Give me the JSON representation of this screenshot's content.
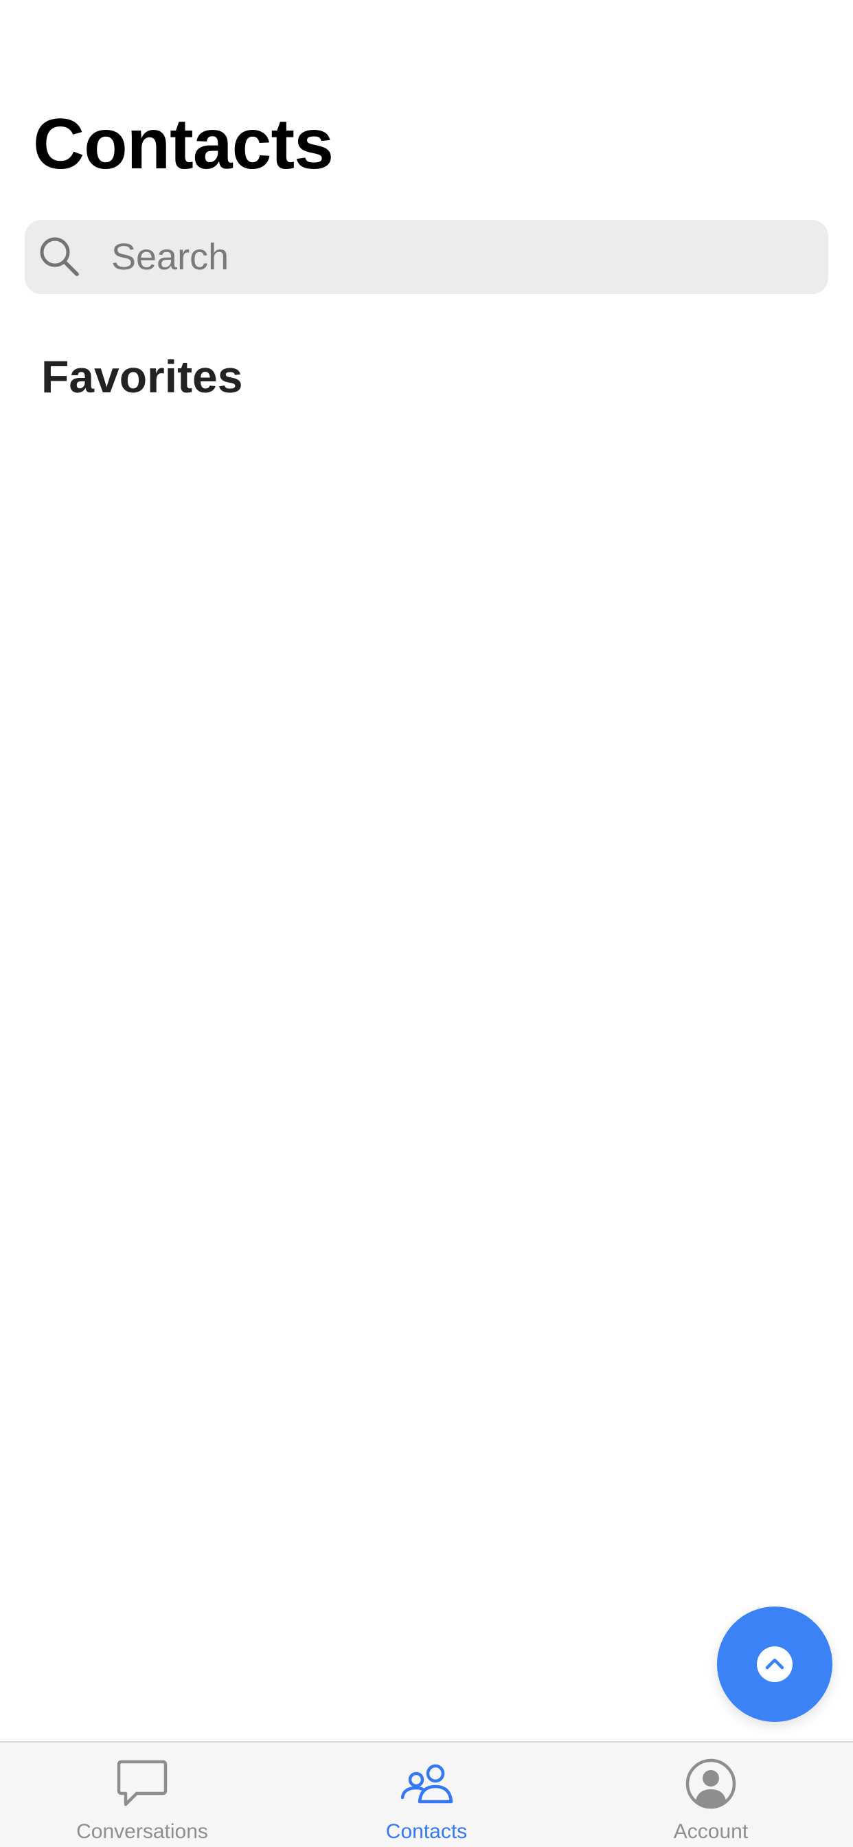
{
  "page": {
    "title": "Contacts"
  },
  "search": {
    "placeholder": "Search",
    "value": "",
    "icon": "search-icon"
  },
  "favorites": {
    "title": "Favorites",
    "items": []
  },
  "fab": {
    "icon": "chevron-up-icon",
    "color": "#3b82f6"
  },
  "tabs": {
    "active_index": 1,
    "active_color": "#3478f6",
    "inactive_color": "#8e8e8e",
    "items": [
      {
        "label": "Conversations",
        "icon": "chat-bubble-icon"
      },
      {
        "label": "Contacts",
        "icon": "people-icon"
      },
      {
        "label": "Account",
        "icon": "account-circle-icon"
      }
    ]
  }
}
